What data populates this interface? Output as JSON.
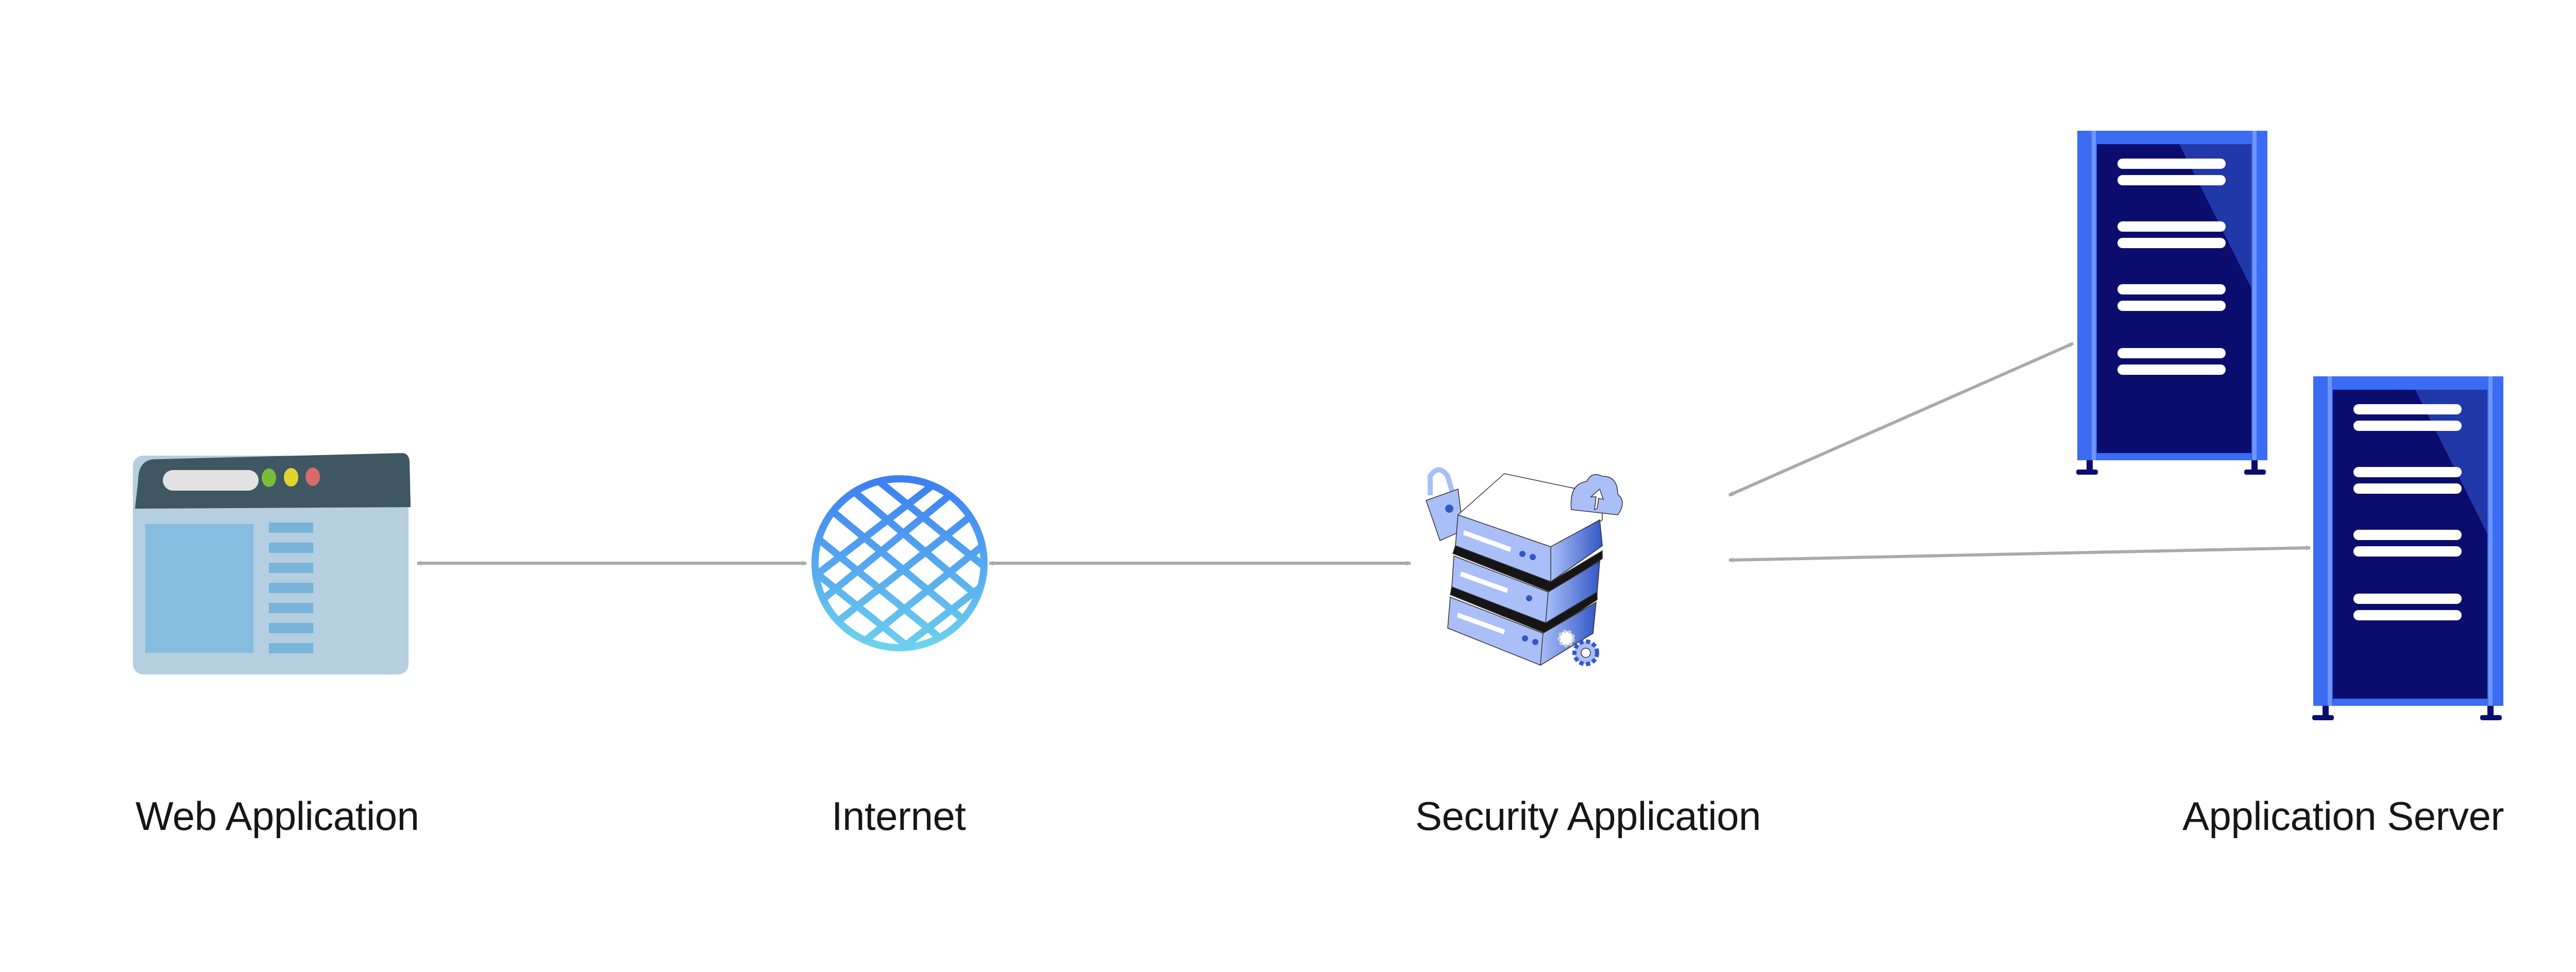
{
  "nodes": [
    {
      "id": "web",
      "label": "Web Application",
      "icon": "browser-window-icon"
    },
    {
      "id": "internet",
      "label": "Internet",
      "icon": "globe-icon"
    },
    {
      "id": "security",
      "label": "Security Application",
      "icon": "secure-server-stack-icon"
    },
    {
      "id": "server",
      "label": "Application Server",
      "icon": "server-rack-icon"
    }
  ],
  "edges": [
    {
      "from": "web",
      "to": "internet",
      "direction": "both"
    },
    {
      "from": "internet",
      "to": "security",
      "direction": "both"
    },
    {
      "from": "security",
      "to": "server",
      "direction": "both"
    },
    {
      "from": "security",
      "to": "server",
      "direction": "both"
    }
  ],
  "colors": {
    "arrow": "#aaaaaa",
    "rack": "#3b6cf2",
    "rack_inner": "#0b0d6e",
    "stack": "#aabff8",
    "stack_dark": "#3358c6"
  }
}
